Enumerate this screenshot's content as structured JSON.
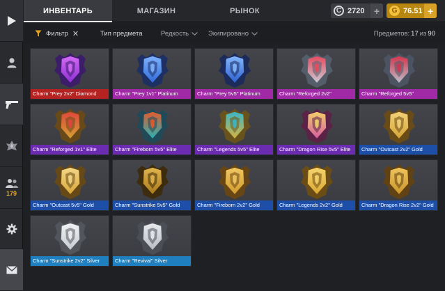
{
  "tabs": [
    {
      "label": "ИНВЕНТАРЬ",
      "active": true
    },
    {
      "label": "МАГАЗИН",
      "active": false
    },
    {
      "label": "РЫНОК",
      "active": false
    }
  ],
  "currency": {
    "credits": {
      "icon": "C",
      "value": "2720",
      "plus": "+"
    },
    "gold": {
      "icon": "G",
      "value": "76.51",
      "plus": "+"
    }
  },
  "sidebar": {
    "friends_count": "179"
  },
  "filters": {
    "filter_label": "Фильтр",
    "clear_symbol": "✕",
    "type_label": "Тип предмета",
    "rarity_label": "Редкость",
    "equipped_label": "Экипировано",
    "items_label": "Предметов:",
    "items_shown": "17",
    "items_of": "из",
    "items_total": "90"
  },
  "items": [
    {
      "name": "Charm \"Prey 2v2\" Diamond",
      "rarity": "diamond",
      "palette": [
        "#8a2fd0",
        "#d56af5",
        "#3b1a6d"
      ]
    },
    {
      "name": "Charm \"Prey 1v1\" Platinum",
      "rarity": "platinum",
      "palette": [
        "#2f6bd8",
        "#7fb2ff",
        "#1b2f66"
      ]
    },
    {
      "name": "Charm \"Prey 5v5\" Platinum",
      "rarity": "platinum",
      "palette": [
        "#2b5fcc",
        "#86b8ff",
        "#18295c"
      ]
    },
    {
      "name": "Charm \"Reforged 2v2\"",
      "rarity": "platinum",
      "palette": [
        "#c8ccd6",
        "#e84a5f",
        "#56606e"
      ]
    },
    {
      "name": "Charm \"Reforged 5v5\"",
      "rarity": "platinum",
      "palette": [
        "#b9bfca",
        "#d6354c",
        "#4e5766"
      ]
    },
    {
      "name": "Charm \"Reforged 1v1\" Elite",
      "rarity": "elite",
      "palette": [
        "#d4a233",
        "#e0463e",
        "#6b4a15"
      ]
    },
    {
      "name": "Charm \"Fireborn 5v5\" Elite",
      "rarity": "elite",
      "palette": [
        "#23b3b8",
        "#e45a2c",
        "#1d4b5a"
      ]
    },
    {
      "name": "Charm \"Legends 5v5\" Elite",
      "rarity": "elite",
      "palette": [
        "#d9b23c",
        "#39b7c9",
        "#6d5418"
      ]
    },
    {
      "name": "Charm \"Dragon Rise 5v5\" Elite",
      "rarity": "elite",
      "palette": [
        "#d45aa0",
        "#f1d06a",
        "#5d2047"
      ]
    },
    {
      "name": "Charm \"Outcast 2v2\" Gold",
      "rarity": "gold",
      "palette": [
        "#d5a437",
        "#f3d37a",
        "#6e4d14"
      ]
    },
    {
      "name": "Charm \"Outcast 5v5\" Gold",
      "rarity": "gold",
      "palette": [
        "#d6a63a",
        "#f5d889",
        "#6a4a12"
      ]
    },
    {
      "name": "Charm \"Sunstrike 5v5\" Gold",
      "rarity": "gold",
      "palette": [
        "#a8791c",
        "#e2b64f",
        "#3d2a08"
      ]
    },
    {
      "name": "Charm \"Fireborn 2v2\" Gold",
      "rarity": "gold",
      "palette": [
        "#d19a2e",
        "#f0c864",
        "#6b4610"
      ]
    },
    {
      "name": "Charm \"Legends 2v2\" Gold",
      "rarity": "gold",
      "palette": [
        "#d9a733",
        "#f6d56f",
        "#6f4e11"
      ]
    },
    {
      "name": "Charm \"Dragon Rise 2v2\" Gold",
      "rarity": "gold",
      "palette": [
        "#c9952b",
        "#efc55e",
        "#654210"
      ]
    },
    {
      "name": "Charm \"Sunstrike 2v2\" Silver",
      "rarity": "silver",
      "palette": [
        "#c6c9cf",
        "#f2f3f5",
        "#55585e"
      ]
    },
    {
      "name": "Charm \"Revival\" Silver",
      "rarity": "silver",
      "palette": [
        "#b8bcc3",
        "#e9ebee",
        "#4d5057"
      ]
    }
  ]
}
